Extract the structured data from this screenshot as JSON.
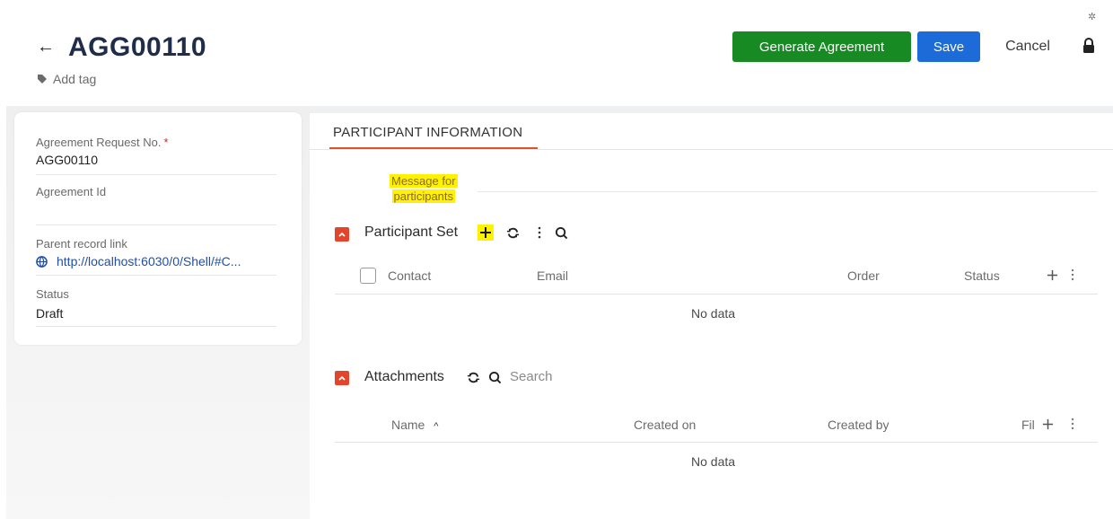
{
  "header": {
    "back_icon": "back-arrow-icon",
    "title": "AGG00110",
    "add_tag": "Add tag",
    "generate_label": "Generate Agreement",
    "save_label": "Save",
    "cancel_label": "Cancel",
    "colors": {
      "generate": "#178a24",
      "save": "#1d6bd8",
      "accent": "#e2452b"
    }
  },
  "left_panel": {
    "fields": [
      {
        "label": "Agreement Request No.",
        "required": true,
        "value": "AGG00110"
      },
      {
        "label": "Agreement Id",
        "value": ""
      },
      {
        "label": "Parent record link",
        "value": "http://localhost:6030/0/Shell/#C..."
      },
      {
        "label": "Status",
        "value": "Draft"
      }
    ],
    "required_mark": "*"
  },
  "main": {
    "tab": "PARTICIPANT INFORMATION",
    "message_label_1": "Message for",
    "message_label_2": "participants",
    "participant_set": {
      "title": "Participant Set",
      "columns": [
        "Contact",
        "Email",
        "Order",
        "Status"
      ],
      "empty": "No data"
    },
    "attachments": {
      "title": "Attachments",
      "search_placeholder": "Search",
      "columns": [
        "Name",
        "Created on",
        "Created by",
        "Fil"
      ],
      "sort_indicator": "^",
      "empty": "No data"
    }
  }
}
